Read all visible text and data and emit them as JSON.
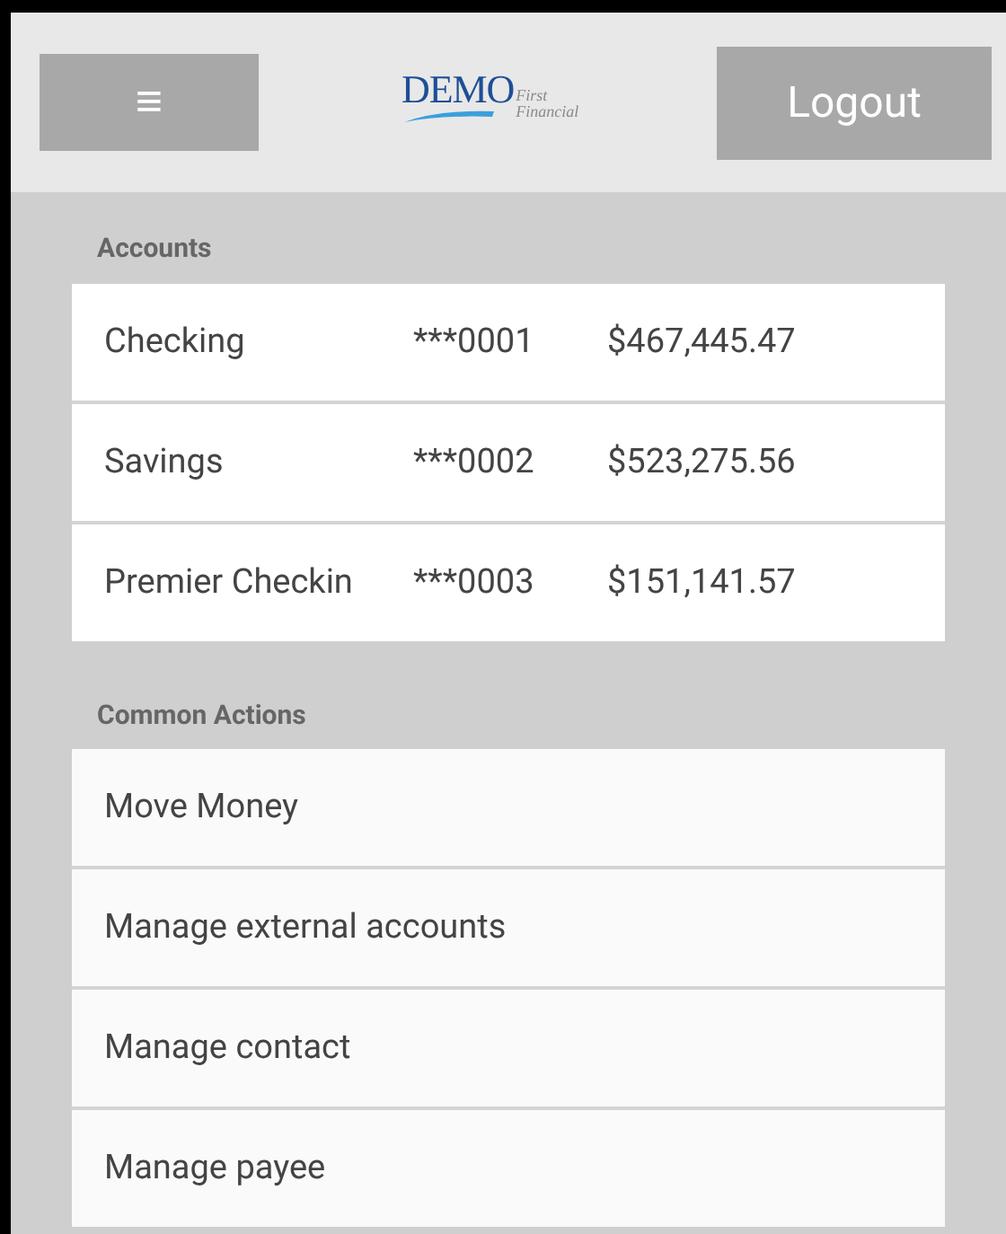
{
  "header": {
    "menu_button": "≡",
    "logo": {
      "wordmark": "DEMO",
      "tagline_1": "First",
      "tagline_2": "Financial"
    },
    "logout_button": "Logout"
  },
  "accounts": {
    "title": "Accounts",
    "rows": [
      {
        "name": "Checking",
        "number": "***0001",
        "balance": "$467,445.47"
      },
      {
        "name": "Savings",
        "number": "***0002",
        "balance": "$523,275.56"
      },
      {
        "name": "Premier Checkin",
        "number": "***0003",
        "balance": "$151,141.57"
      }
    ]
  },
  "common_actions": {
    "title": "Common Actions",
    "items": [
      "Move Money",
      "Manage external accounts",
      "Manage contact",
      "Manage payee"
    ]
  }
}
